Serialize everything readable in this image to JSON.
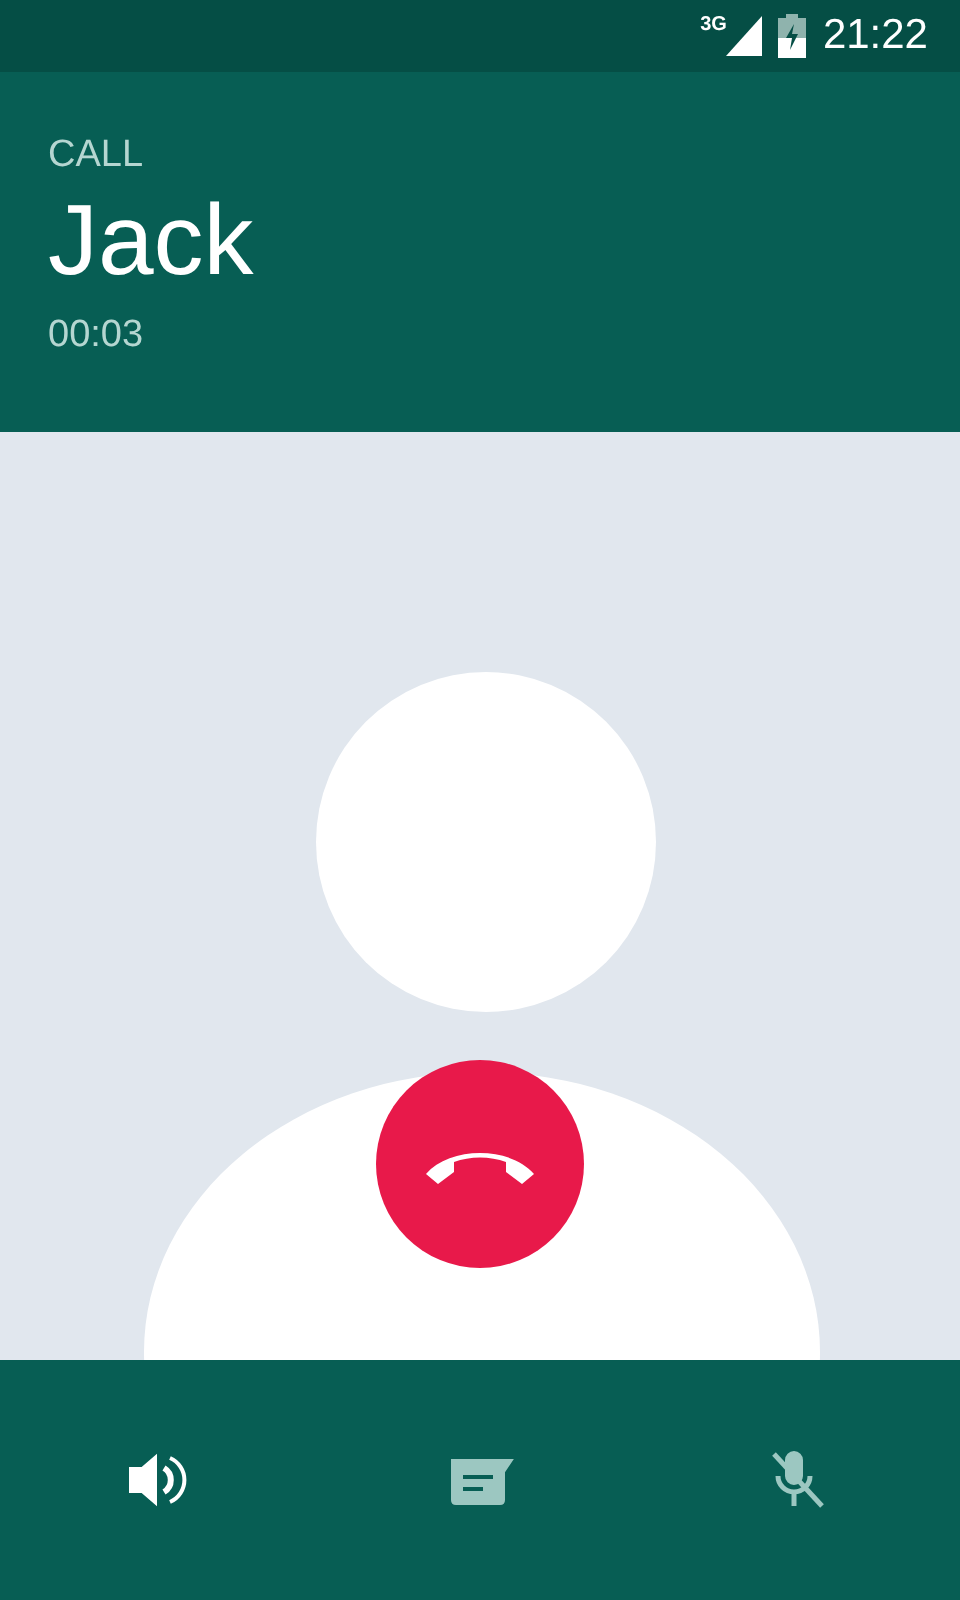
{
  "status_bar": {
    "network": "3G",
    "time": "21:22"
  },
  "header": {
    "label": "CALL",
    "name": "Jack",
    "duration": "00:03"
  },
  "controls": [
    {
      "kind": "speaker",
      "active": true
    },
    {
      "kind": "message",
      "active": false
    },
    {
      "kind": "mute",
      "active": false
    }
  ]
}
